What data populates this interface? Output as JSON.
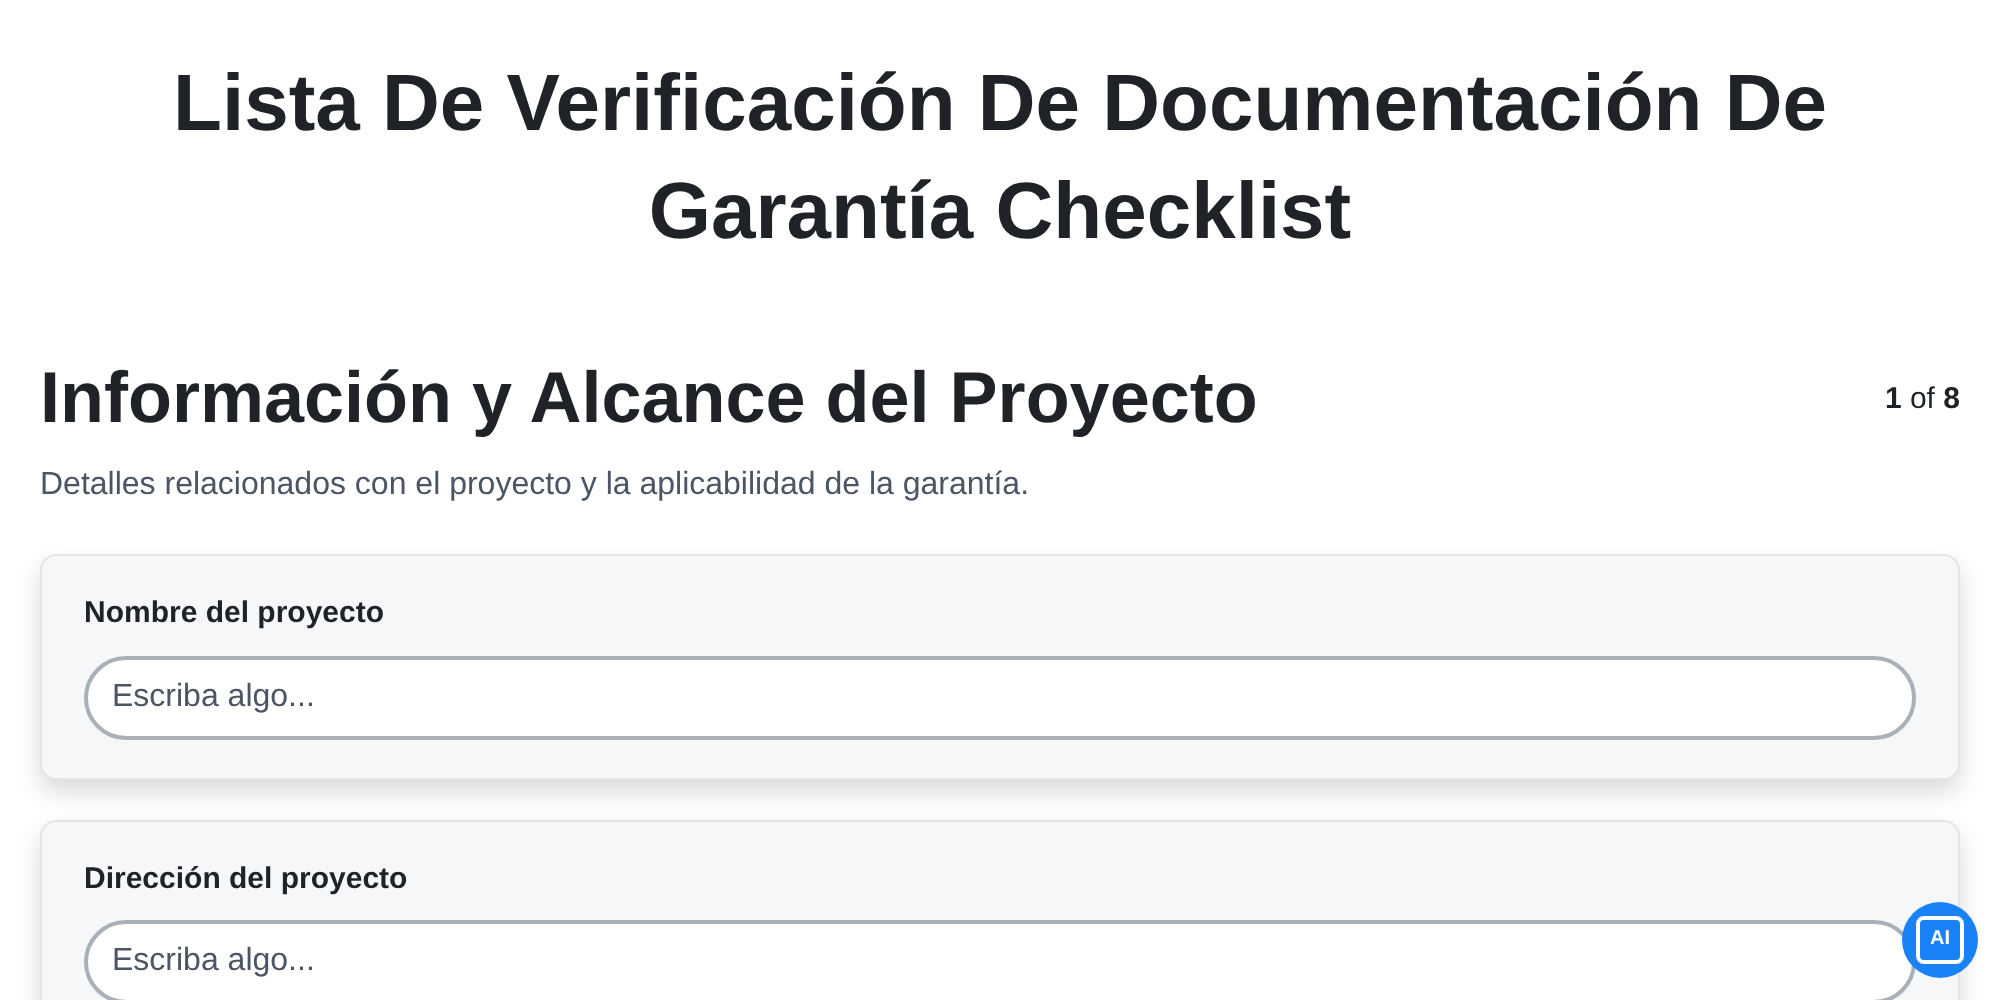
{
  "title": "Lista De Verificación De Documentación De Garantía Checklist",
  "section": {
    "heading": "Información y Alcance del Proyecto",
    "page_indicator": "**1** of **8**",
    "description": "Detalles relacionados con el proyecto y la aplicabilidad de la garantía."
  },
  "fields": [
    {
      "label": "Nombre del proyecto",
      "placeholder": "Escriba algo..."
    },
    {
      "label": "Dirección del proyecto",
      "placeholder": "Escriba algo..."
    }
  ],
  "assistant_button": {
    "label": "AI"
  }
}
